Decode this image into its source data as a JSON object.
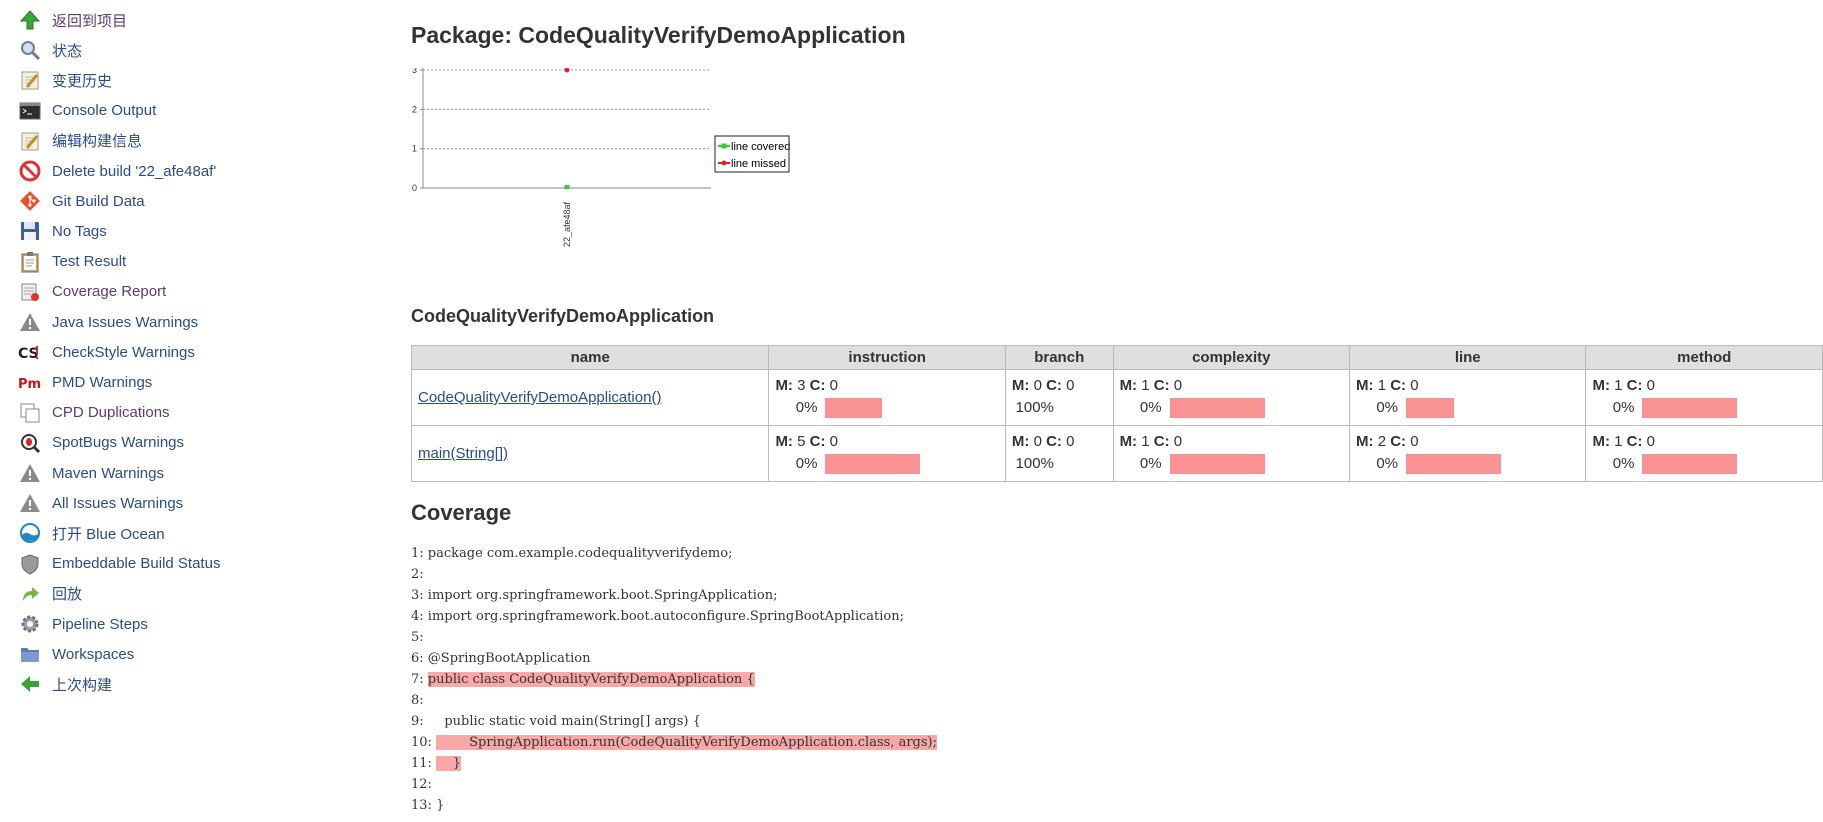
{
  "sidebar": {
    "items": [
      {
        "label": "返回到项目",
        "icon": "arrow-up-icon"
      },
      {
        "label": "状态",
        "icon": "magnifier-icon"
      },
      {
        "label": "变更历史",
        "icon": "notepad-icon"
      },
      {
        "label": "Console Output",
        "icon": "terminal-icon"
      },
      {
        "label": "编辑构建信息",
        "icon": "notepad-icon"
      },
      {
        "label": "Delete build '22_afe48af'",
        "icon": "no-entry-icon"
      },
      {
        "label": "Git Build Data",
        "icon": "git-icon"
      },
      {
        "label": "No Tags",
        "icon": "floppy-disk-icon"
      },
      {
        "label": "Test Result",
        "icon": "clipboard-icon"
      },
      {
        "label": "Coverage Report",
        "icon": "coverage-icon"
      },
      {
        "label": "Java Issues Warnings",
        "icon": "warning-triangle-icon"
      },
      {
        "label": "CheckStyle Warnings",
        "icon": "checkstyle-icon"
      },
      {
        "label": "PMD Warnings",
        "icon": "pmd-icon"
      },
      {
        "label": "CPD Duplications",
        "icon": "duplicate-icon"
      },
      {
        "label": "SpotBugs Warnings",
        "icon": "bug-magnifier-icon"
      },
      {
        "label": "Maven Warnings",
        "icon": "warning-triangle-icon"
      },
      {
        "label": "All Issues Warnings",
        "icon": "warning-triangle-icon"
      },
      {
        "label": "打开 Blue Ocean",
        "icon": "blue-ocean-icon"
      },
      {
        "label": "Embeddable Build Status",
        "icon": "shield-icon"
      },
      {
        "label": "回放",
        "icon": "replay-arrow-icon"
      },
      {
        "label": "Pipeline Steps",
        "icon": "gear-icon"
      },
      {
        "label": "Workspaces",
        "icon": "folder-icon"
      },
      {
        "label": "上次构建",
        "icon": "arrow-left-icon"
      }
    ]
  },
  "page": {
    "title": "Package: CodeQualityVerifyDemoApplication",
    "class_heading": "CodeQualityVerifyDemoApplication",
    "coverage_heading": "Coverage"
  },
  "chart_data": {
    "type": "line",
    "categories": [
      "22_afe48af"
    ],
    "series": [
      {
        "name": "line covered",
        "values": [
          0
        ],
        "color": "#33cc33"
      },
      {
        "name": "line missed",
        "values": [
          3
        ],
        "color": "#e0202a"
      }
    ],
    "yticks": [
      "0",
      "1",
      "2",
      "3"
    ],
    "ylim": [
      0,
      3
    ],
    "legend": "right",
    "grid": true
  },
  "table": {
    "headers": [
      "name",
      "instruction",
      "branch",
      "complexity",
      "line",
      "method"
    ],
    "rows": [
      {
        "name": "CodeQualityVerifyDemoApplication()",
        "cells": [
          {
            "M": "3",
            "C": "0",
            "pct": "0%",
            "missed_fraction": 1
          },
          {
            "M": "0",
            "C": "0",
            "pct": "100%",
            "missed_fraction": 0
          },
          {
            "M": "1",
            "C": "0",
            "pct": "0%",
            "missed_fraction": 1
          },
          {
            "M": "1",
            "C": "0",
            "pct": "0%",
            "missed_fraction": 1
          },
          {
            "M": "1",
            "C": "0",
            "pct": "0%",
            "missed_fraction": 1
          }
        ]
      },
      {
        "name": "main(String[])",
        "cells": [
          {
            "M": "5",
            "C": "0",
            "pct": "0%",
            "missed_fraction": 1
          },
          {
            "M": "0",
            "C": "0",
            "pct": "100%",
            "missed_fraction": 0
          },
          {
            "M": "1",
            "C": "0",
            "pct": "0%",
            "missed_fraction": 1
          },
          {
            "M": "2",
            "C": "0",
            "pct": "0%",
            "missed_fraction": 1
          },
          {
            "M": "1",
            "C": "0",
            "pct": "0%",
            "missed_fraction": 1
          }
        ]
      }
    ]
  },
  "code_lines": [
    {
      "num": "1:",
      "text": "package com.example.codequalityverifydemo;",
      "missed": false
    },
    {
      "num": "2:",
      "text": "",
      "missed": false
    },
    {
      "num": "3:",
      "text": "import org.springframework.boot.SpringApplication;",
      "missed": false
    },
    {
      "num": "4:",
      "text": "import org.springframework.boot.autoconfigure.SpringBootApplication;",
      "missed": false
    },
    {
      "num": "5:",
      "text": "",
      "missed": false
    },
    {
      "num": "6:",
      "text": "@SpringBootApplication",
      "missed": false
    },
    {
      "num": "7:",
      "text": "public class CodeQualityVerifyDemoApplication {",
      "missed": true
    },
    {
      "num": "8:",
      "text": "",
      "missed": false
    },
    {
      "num": "9:",
      "text": "    public static void main(String[] args) {",
      "missed": false
    },
    {
      "num": "10:",
      "text": "        SpringApplication.run(CodeQualityVerifyDemoApplication.class, args);",
      "missed": true
    },
    {
      "num": "11:",
      "text": "    }",
      "missed": true
    },
    {
      "num": "12:",
      "text": "",
      "missed": false
    },
    {
      "num": "13:",
      "text": "}",
      "missed": false
    }
  ],
  "colors": {
    "link": "#2a4b8d",
    "missed_bar": "#f99393",
    "missed_line": "#f9a8a8"
  }
}
